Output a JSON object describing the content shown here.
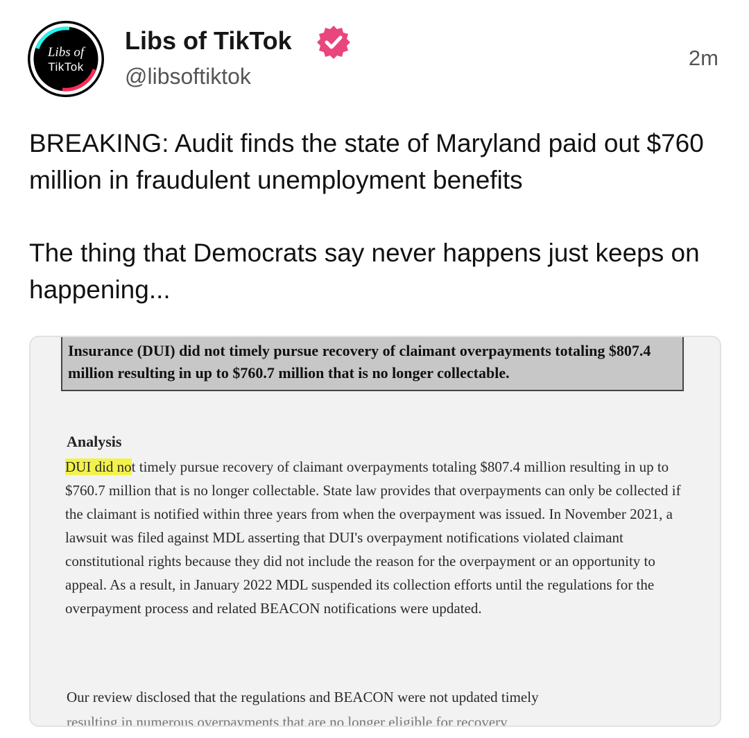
{
  "account": {
    "avatar_line1": "Libs of",
    "avatar_line2": "TikTok",
    "display_name": "Libs of TikTok",
    "handle": "@libsoftiktok",
    "timestamp": "2m",
    "verified_icon": "verified-badge-icon",
    "badge_color": "#e8467c"
  },
  "post": {
    "paragraph1": "BREAKING: Audit finds the state of Maryland paid out $760 million in fraudulent unemployment benefits",
    "paragraph2": "The thing that Democrats say never happens just keeps on happening..."
  },
  "document": {
    "finding": "Insurance (DUI) did not timely pursue recovery of claimant overpayments totaling $807.4 million resulting in up to $760.7 million that is no longer collectable.",
    "analysis_heading": "Analysis",
    "highlight": "DUI did no",
    "analysis_rest": "t timely pursue recovery of claimant overpayments totaling $807.4 million resulting in up to $760.7 million that is no longer collectable.  State law provides that overpayments can only be collected if the claimant is notified within three years from when the overpayment was issued.  In November 2021, a lawsuit was filed against MDL asserting that DUI's overpayment notifications violated claimant constitutional rights because they did not include the reason for the overpayment or an opportunity to appeal.  As a result, in January 2022 MDL suspended its collection efforts until the regulations for the overpayment process and related BEACON notifications were updated.",
    "review_line": "Our review disclosed that the regulations and BEACON were not updated timely",
    "cut_line": "resulting in numerous overpayments that are no longer eligible for recovery"
  }
}
